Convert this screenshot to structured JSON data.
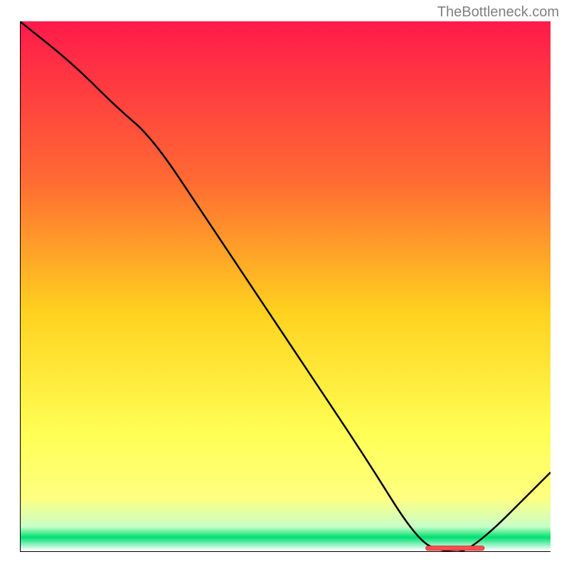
{
  "watermark": "TheBottleneck.com",
  "chart_data": {
    "type": "line",
    "title": "",
    "xlabel": "",
    "ylabel": "",
    "x": [
      0.0,
      0.1,
      0.18,
      0.25,
      0.35,
      0.45,
      0.55,
      0.65,
      0.75,
      0.8,
      0.85,
      1.0
    ],
    "values": [
      1.0,
      0.92,
      0.84,
      0.78,
      0.63,
      0.48,
      0.33,
      0.18,
      0.02,
      0.0,
      0.0,
      0.15
    ],
    "xlim": [
      0,
      1
    ],
    "ylim": [
      0,
      1
    ],
    "gradient": {
      "top": "#ff1a4a",
      "upper_mid": "#ff6a33",
      "mid": "#ffd21f",
      "lower_mid": "#ffff80",
      "bottom_band": "#00e070",
      "bottom_edge": "#ffffff"
    },
    "marker": {
      "x_center": 0.82,
      "x_half_width": 0.055,
      "y": 0.003,
      "color": "#ff4d4d"
    }
  }
}
